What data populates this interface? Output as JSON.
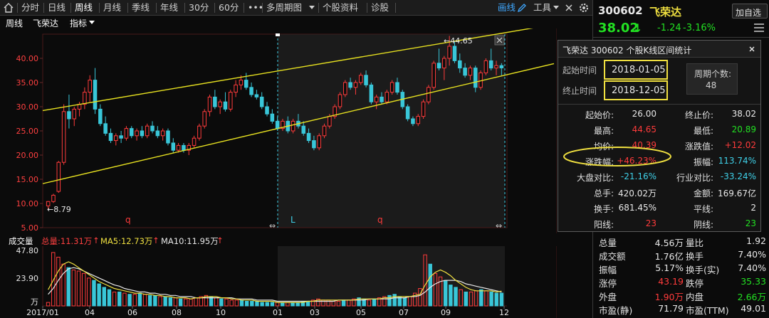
{
  "toolbar": {
    "items": [
      "分时",
      "日线",
      "周线",
      "月线",
      "季线",
      "年线",
      "30分",
      "60分",
      "•••",
      "多周期图",
      "个股资料",
      "诊股"
    ],
    "draw_label": "画线",
    "tools_label": "工具",
    "active": "周线"
  },
  "subheader": {
    "period": "周线",
    "name": "飞荣达",
    "indicator": "指标"
  },
  "chart_data": [
    {
      "type": "candlestick",
      "period": "weekly",
      "ylim": [
        5.0,
        45.0
      ],
      "y_ticks": [
        "40.00",
        "35.00",
        "30.00",
        "25.00",
        "20.00",
        "15.00",
        "10.00",
        "5.00"
      ],
      "annotations": {
        "high_label": "44.65",
        "low_label": "8.79"
      },
      "interval_markers": [
        "q",
        "L",
        "q"
      ],
      "candles": [
        [
          9.5,
          10.5,
          8.79,
          10.4
        ],
        [
          10.4,
          12.0,
          10.1,
          11.7
        ],
        [
          12.5,
          18.8,
          12.2,
          18.5
        ],
        [
          18.5,
          30.5,
          18.0,
          29.0
        ],
        [
          29.0,
          32.5,
          25.5,
          27.5
        ],
        [
          27.5,
          30.0,
          26.0,
          29.5
        ],
        [
          29.5,
          31.0,
          28.0,
          30.5
        ],
        [
          30.5,
          34.0,
          29.5,
          33.0
        ],
        [
          33.0,
          36.5,
          31.0,
          35.5
        ],
        [
          35.5,
          38.0,
          28.5,
          29.5
        ],
        [
          29.5,
          30.5,
          26.0,
          26.5
        ],
        [
          26.5,
          28.0,
          24.0,
          24.5
        ],
        [
          24.5,
          25.5,
          22.5,
          23.0
        ],
        [
          23.0,
          24.5,
          22.0,
          24.0
        ],
        [
          24.0,
          25.0,
          22.5,
          23.5
        ],
        [
          23.5,
          26.0,
          23.0,
          25.5
        ],
        [
          25.5,
          26.0,
          23.5,
          24.0
        ],
        [
          24.0,
          25.5,
          23.0,
          25.0
        ],
        [
          25.0,
          26.0,
          23.5,
          24.0
        ],
        [
          24.0,
          26.5,
          23.5,
          26.0
        ],
        [
          26.0,
          27.0,
          24.5,
          25.0
        ],
        [
          25.0,
          26.0,
          23.5,
          24.0
        ],
        [
          24.0,
          25.5,
          23.0,
          25.0
        ],
        [
          25.0,
          25.5,
          22.0,
          22.5
        ],
        [
          22.5,
          23.5,
          20.5,
          21.0
        ],
        [
          21.0,
          22.5,
          20.5,
          22.0
        ],
        [
          22.0,
          22.5,
          20.5,
          21.0
        ],
        [
          21.0,
          22.5,
          20.0,
          22.0
        ],
        [
          22.0,
          24.0,
          21.5,
          23.5
        ],
        [
          23.5,
          26.5,
          23.0,
          26.0
        ],
        [
          26.0,
          29.5,
          25.5,
          29.0
        ],
        [
          29.0,
          32.5,
          28.0,
          32.0
        ],
        [
          32.0,
          33.5,
          29.5,
          30.0
        ],
        [
          30.0,
          31.5,
          28.5,
          31.0
        ],
        [
          31.0,
          33.0,
          29.0,
          29.5
        ],
        [
          29.5,
          33.5,
          29.0,
          33.0
        ],
        [
          33.0,
          35.5,
          32.0,
          34.5
        ],
        [
          34.5,
          36.5,
          33.5,
          35.5
        ],
        [
          35.5,
          37.0,
          33.5,
          34.0
        ],
        [
          34.0,
          35.0,
          32.0,
          32.5
        ],
        [
          32.5,
          33.5,
          31.5,
          32.0
        ],
        [
          32.0,
          33.0,
          29.5,
          30.0
        ],
        [
          30.0,
          31.0,
          28.0,
          28.5
        ],
        [
          28.5,
          29.5,
          26.5,
          27.0
        ],
        [
          27.0,
          28.0,
          25.0,
          25.5
        ],
        [
          25.5,
          27.5,
          25.0,
          27.0
        ],
        [
          27.0,
          28.0,
          24.5,
          25.0
        ],
        [
          25.0,
          27.5,
          24.5,
          27.0
        ],
        [
          27.0,
          28.5,
          25.5,
          26.0
        ],
        [
          26.0,
          27.0,
          24.0,
          24.5
        ],
        [
          24.5,
          25.5,
          22.5,
          23.0
        ],
        [
          23.0,
          24.0,
          21.0,
          21.5
        ],
        [
          21.5,
          24.5,
          21.0,
          24.0
        ],
        [
          24.0,
          26.5,
          23.5,
          26.0
        ],
        [
          26.0,
          28.5,
          25.5,
          28.0
        ],
        [
          28.0,
          30.5,
          27.5,
          30.0
        ],
        [
          30.0,
          33.0,
          29.5,
          32.5
        ],
        [
          32.5,
          35.5,
          32.0,
          35.0
        ],
        [
          35.0,
          36.0,
          33.5,
          34.0
        ],
        [
          34.0,
          35.5,
          32.5,
          35.0
        ],
        [
          35.0,
          37.0,
          34.5,
          36.5
        ],
        [
          36.5,
          37.5,
          34.0,
          34.5
        ],
        [
          34.5,
          35.0,
          30.5,
          31.0
        ],
        [
          31.0,
          32.5,
          29.5,
          32.0
        ],
        [
          32.0,
          33.0,
          30.5,
          31.0
        ],
        [
          31.0,
          33.5,
          30.5,
          33.0
        ],
        [
          33.0,
          35.5,
          32.5,
          35.0
        ],
        [
          35.0,
          36.0,
          32.5,
          33.0
        ],
        [
          33.0,
          33.5,
          29.5,
          30.0
        ],
        [
          30.0,
          30.5,
          27.0,
          27.5
        ],
        [
          27.5,
          28.0,
          26.0,
          26.5
        ],
        [
          26.5,
          28.5,
          26.0,
          28.0
        ],
        [
          28.0,
          31.5,
          27.5,
          31.0
        ],
        [
          31.0,
          34.5,
          30.5,
          34.0
        ],
        [
          34.0,
          39.5,
          33.5,
          39.0
        ],
        [
          39.0,
          42.0,
          37.5,
          38.0
        ],
        [
          38.0,
          40.5,
          35.5,
          40.0
        ],
        [
          40.0,
          44.65,
          38.5,
          42.5
        ],
        [
          42.5,
          43.5,
          39.0,
          39.5
        ],
        [
          39.5,
          41.0,
          37.0,
          38.0
        ],
        [
          38.0,
          39.0,
          36.0,
          36.5
        ],
        [
          36.5,
          38.5,
          35.5,
          38.0
        ],
        [
          38.0,
          38.5,
          33.0,
          34.0
        ],
        [
          34.0,
          37.5,
          33.5,
          37.0
        ],
        [
          37.0,
          40.0,
          36.5,
          39.5
        ],
        [
          39.5,
          42.0,
          37.5,
          38.0
        ],
        [
          38.0,
          39.5,
          36.5,
          38.5
        ],
        [
          38.5,
          39.0,
          36.5,
          38.02
        ]
      ]
    },
    {
      "type": "bar",
      "title": "成交量",
      "y_ticks": [
        "47.80",
        "23.90",
        "万"
      ],
      "x_ticks": [
        "2017/01",
        "04",
        "06",
        "08",
        "10",
        "01",
        "03",
        "05",
        "07",
        "09",
        "12"
      ],
      "legend": [
        {
          "label": "总量:11.31万",
          "color": "#ff4040"
        },
        {
          "label": "MA5:12.73万",
          "color": "#f0e040"
        },
        {
          "label": "MA10:11.95万",
          "color": "#e8e8e8"
        }
      ],
      "values": [
        3,
        46,
        42,
        36,
        33,
        31,
        30,
        28,
        24,
        22,
        19,
        16,
        14,
        12,
        12,
        11,
        10,
        10,
        11,
        10,
        9,
        9,
        8,
        8,
        7,
        7,
        6,
        6,
        6,
        7,
        8,
        9,
        8,
        7,
        6,
        6,
        5,
        5,
        5,
        4,
        4,
        4,
        3,
        3,
        3,
        3,
        3,
        3,
        3,
        3,
        4,
        4,
        5,
        6,
        5,
        5,
        4,
        4,
        5,
        5,
        6,
        7,
        6,
        5,
        6,
        7,
        8,
        9,
        10,
        8,
        7,
        8,
        11,
        15,
        44,
        36,
        28,
        25,
        22,
        18,
        16,
        14,
        12,
        12,
        13,
        14,
        13,
        12,
        11,
        11
      ],
      "ma5": [
        14,
        22,
        30,
        36,
        38,
        36,
        33,
        30,
        27,
        24,
        21,
        19,
        17,
        15,
        14,
        13,
        12,
        11,
        11,
        10,
        10,
        9,
        9,
        8,
        8,
        7,
        7,
        7,
        6,
        7,
        7,
        8,
        8,
        8,
        7,
        7,
        6,
        6,
        5,
        5,
        5,
        4,
        4,
        4,
        4,
        3,
        3,
        3,
        3,
        3,
        3,
        4,
        4,
        5,
        5,
        5,
        5,
        5,
        5,
        5,
        5,
        6,
        6,
        6,
        6,
        6,
        7,
        7,
        8,
        8,
        8,
        8,
        9,
        10,
        18,
        25,
        29,
        31,
        29,
        26,
        22,
        19,
        16,
        14,
        13,
        13,
        13,
        13,
        12,
        12.73
      ],
      "ma10": [
        10,
        15,
        22,
        28,
        32,
        33,
        32,
        30,
        28,
        26,
        24,
        22,
        20,
        18,
        17,
        15,
        14,
        13,
        12,
        12,
        11,
        11,
        10,
        10,
        9,
        9,
        8,
        8,
        8,
        7,
        7,
        7,
        7,
        7,
        7,
        7,
        7,
        6,
        6,
        6,
        6,
        5,
        5,
        5,
        5,
        4,
        4,
        4,
        4,
        4,
        4,
        4,
        4,
        4,
        4,
        4,
        4,
        5,
        5,
        5,
        5,
        5,
        5,
        6,
        6,
        6,
        6,
        6,
        7,
        7,
        7,
        8,
        8,
        9,
        12,
        16,
        19,
        21,
        22,
        22,
        22,
        21,
        19,
        18,
        17,
        16,
        15,
        14,
        13,
        11.95
      ]
    }
  ],
  "popup": {
    "title": "飞荣达  300602  个股K线区间统计",
    "start_label": "起始时间",
    "start_value": "2018-01-05",
    "end_label": "终止时间",
    "end_value": "2018-12-05",
    "period_count_label": "周期个数:",
    "period_count_value": "48",
    "stats": [
      {
        "label": "起始价:",
        "value": "26.00",
        "label2": "终止价:",
        "value2": "38.02",
        "c1": "white",
        "c2": "white"
      },
      {
        "label": "最高:",
        "value": "44.65",
        "label2": "最低:",
        "value2": "20.89",
        "c1": "red",
        "c2": "green"
      },
      {
        "label": "均价:",
        "value": "40.39",
        "label2": "涨跌值:",
        "value2": "+12.02",
        "c1": "red",
        "c2": "red"
      },
      {
        "label": "涨跌幅:",
        "value": "+46.23%",
        "label2": "振幅:",
        "value2": "113.74%",
        "c1": "red",
        "c2": "cyan"
      },
      {
        "label": "大盘对比:",
        "value": "-21.16%",
        "label2": "行业对比:",
        "value2": "-33.24%",
        "c1": "cyan",
        "c2": "cyan"
      },
      {
        "label": "总手:",
        "value": "420.02万",
        "label2": "金额:",
        "value2": "169.67亿",
        "c1": "white",
        "c2": "white"
      },
      {
        "label": "换手:",
        "value": "681.45%",
        "label2": "平线:",
        "value2": "2",
        "c1": "white",
        "c2": "white"
      },
      {
        "label": "阳线:",
        "value": "23",
        "label2": "阴线:",
        "value2": "23",
        "c1": "red",
        "c2": "green"
      }
    ]
  },
  "quote": {
    "code": "300602",
    "name": "飞荣达",
    "add_button": "加自选",
    "price": "38.02",
    "change": "-1.24",
    "change_pct": "-3.16%"
  },
  "quote_stats": [
    {
      "l1": "总量",
      "v1": "4.56万",
      "l2": "量比",
      "v2": "1.92",
      "c1": "white",
      "c2": "white"
    },
    {
      "l1": "成交额",
      "v1": "1.76亿",
      "l2": "换手",
      "v2": "7.40%",
      "c1": "white",
      "c2": "white"
    },
    {
      "l1": "振幅",
      "v1": "5.17%",
      "l2": "换手(实)",
      "v2": "7.40%",
      "c1": "white",
      "c2": "white"
    },
    {
      "l1": "涨停",
      "v1": "43.19",
      "l2": "跌停",
      "v2": "35.33",
      "c1": "red",
      "c2": "green"
    },
    {
      "l1": "外盘",
      "v1": "1.90万",
      "l2": "内盘",
      "v2": "2.66万",
      "c1": "red",
      "c2": "green"
    },
    {
      "l1": "市盈(静)",
      "v1": "71.79",
      "l2": "市盈(TTM)",
      "v2": "49.01",
      "c1": "white",
      "c2": "white"
    }
  ],
  "colors": {
    "up": "#ff3b3b",
    "down": "#39c6d8",
    "trend": "#e6e020",
    "highlight": "#f0e040"
  }
}
